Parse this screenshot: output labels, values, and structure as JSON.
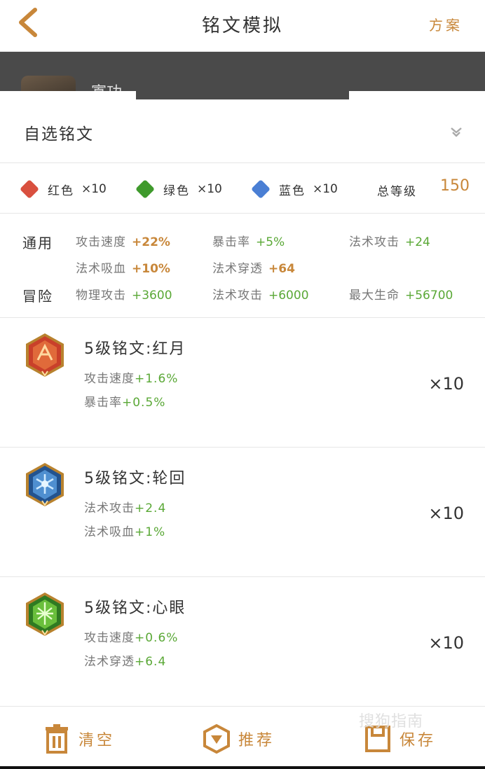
{
  "header": {
    "title": "铭文模拟",
    "plan_label": "方案"
  },
  "hero": {
    "name": "寡功"
  },
  "selector": {
    "label": "自选铭文"
  },
  "colors": {
    "red": {
      "label": "红色",
      "count": "×10",
      "color": "#d9503f"
    },
    "green": {
      "label": "绿色",
      "count": "×10",
      "color": "#3f9a2c"
    },
    "blue": {
      "label": "蓝色",
      "count": "×10",
      "color": "#4a7fd4"
    },
    "total_label": "总等级",
    "total_value": "150"
  },
  "stats": {
    "general": {
      "label": "通用",
      "items": [
        {
          "key": "攻击速度",
          "value": "+22%"
        },
        {
          "key": "暴击率",
          "value": "+5%"
        },
        {
          "key": "法术攻击",
          "value": "+24"
        },
        {
          "key": "法术吸血",
          "value": "+10%"
        },
        {
          "key": "法术穿透",
          "value": "+64"
        }
      ]
    },
    "adventure": {
      "label": "冒险",
      "items": [
        {
          "key": "物理攻击",
          "value": "+3600"
        },
        {
          "key": "法术攻击",
          "value": "+6000"
        },
        {
          "key": "最大生命",
          "value": "+56700"
        }
      ]
    }
  },
  "runes": [
    {
      "name": "5级铭文:红月",
      "icon": "red-moon-rune-icon",
      "lines": [
        {
          "key": "攻击速度",
          "value": "+1.6%"
        },
        {
          "key": "暴击率",
          "value": "+0.5%"
        }
      ],
      "count": "×10"
    },
    {
      "name": "5级铭文:轮回",
      "icon": "reincarnation-rune-icon",
      "lines": [
        {
          "key": "法术攻击",
          "value": "+2.4"
        },
        {
          "key": "法术吸血",
          "value": "+1%"
        }
      ],
      "count": "×10"
    },
    {
      "name": "5级铭文:心眼",
      "icon": "mind-eye-rune-icon",
      "lines": [
        {
          "key": "攻击速度",
          "value": "+0.6%"
        },
        {
          "key": "法术穿透",
          "value": "+6.4"
        }
      ],
      "count": "×10"
    }
  ],
  "bottom_bar": {
    "clear_label": "清空",
    "recommend_label": "推荐",
    "save_label": "保存",
    "watermark": "搜狗指南"
  },
  "accent_color": "#c8873a"
}
